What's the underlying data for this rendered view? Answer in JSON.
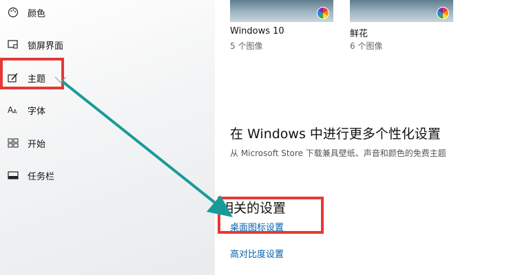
{
  "sidebar": {
    "items": [
      {
        "label": "颜色",
        "icon": "palette-icon"
      },
      {
        "label": "锁屏界面",
        "icon": "lock-screen-icon"
      },
      {
        "label": "主题",
        "icon": "brush-icon"
      },
      {
        "label": "字体",
        "icon": "font-icon"
      },
      {
        "label": "开始",
        "icon": "start-icon"
      },
      {
        "label": "任务栏",
        "icon": "taskbar-icon"
      }
    ]
  },
  "themes": [
    {
      "name": "Windows 10",
      "count": "5 个图像"
    },
    {
      "name": "鲜花",
      "count": "6 个图像"
    }
  ],
  "personalize": {
    "title": "在 Windows 中进行更多个性化设置",
    "subtitle": "从 Microsoft Store 下载兼具壁纸、声音和颜色的免费主题"
  },
  "related": {
    "title": "相关的设置",
    "links": [
      "桌面图标设置",
      "高对比度设置"
    ]
  },
  "colors": {
    "annotation_red": "#e53935",
    "annotation_arrow": "#199a9a",
    "link": "#0063b1"
  }
}
